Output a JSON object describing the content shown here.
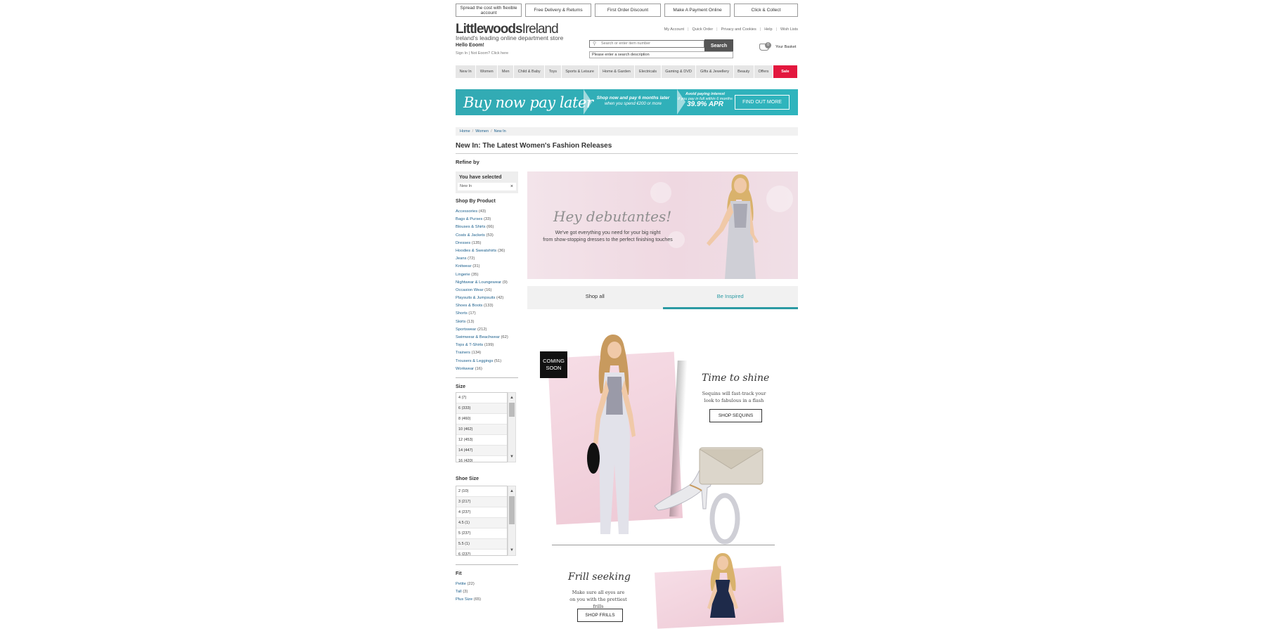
{
  "promos": [
    "Spread the cost with flexible account",
    "Free Delivery & Returns",
    "First Order Discount",
    "Make A Payment Online",
    "Click & Collect"
  ],
  "header": {
    "logo_bold": "Littlewoods",
    "logo_light": "Ireland",
    "tagline": "Ireland's leading online department store",
    "greeting": "Hello Eoom!",
    "signin": "Sign In | Not Eoom? Click here",
    "account_links": [
      "My Account",
      "Quick Order",
      "Privacy and Cookies",
      "Help",
      "Wish Lists"
    ],
    "search_placeholder": "Search or enter item number",
    "search_button": "Search",
    "search_error": "Please enter a search description",
    "basket_count": "0",
    "basket_label": "Your Basket"
  },
  "nav": [
    "New In",
    "Women",
    "Men",
    "Child & Baby",
    "Toys",
    "Sports & Leisure",
    "Home & Garden",
    "Electricals",
    "Gaming & DVD",
    "Gifts & Jewellery",
    "Beauty",
    "Offers",
    "Sale"
  ],
  "banner": {
    "headline": "Buy now pay later",
    "mid_line1": "Shop now and pay 6 months later",
    "mid_line2": "when you spend €200 or more",
    "right_line1": "Avoid paying interest",
    "right_line2": "if you pay in full within 6 months",
    "apr": "39.9% APR",
    "cta": "FIND OUT MORE"
  },
  "breadcrumb": [
    "Home",
    "Women",
    "New In"
  ],
  "page_title": "New In: The Latest Women's Fashion Releases",
  "refine": {
    "label": "Refine by",
    "selected_label": "You have selected",
    "selected_value": "New In",
    "remove": "×",
    "shop_by_product": "Shop By Product",
    "categories": [
      {
        "name": "Accessories",
        "count": "(43)"
      },
      {
        "name": "Bags & Purses",
        "count": "(33)"
      },
      {
        "name": "Blouses & Shirts",
        "count": "(66)"
      },
      {
        "name": "Coats & Jackets",
        "count": "(53)"
      },
      {
        "name": "Dresses",
        "count": "(135)"
      },
      {
        "name": "Hoodies & Sweatshirts",
        "count": "(36)"
      },
      {
        "name": "Jeans",
        "count": "(72)"
      },
      {
        "name": "Knitwear",
        "count": "(31)"
      },
      {
        "name": "Lingerie",
        "count": "(35)"
      },
      {
        "name": "Nightwear & Loungewear",
        "count": "(9)"
      },
      {
        "name": "Occasion Wear",
        "count": "(16)"
      },
      {
        "name": "Playsuits & Jumpsuits",
        "count": "(42)"
      },
      {
        "name": "Shoes & Boots",
        "count": "(133)"
      },
      {
        "name": "Shorts",
        "count": "(17)"
      },
      {
        "name": "Skirts",
        "count": "(13)"
      },
      {
        "name": "Sportswear",
        "count": "(212)"
      },
      {
        "name": "Swimwear & Beachwear",
        "count": "(62)"
      },
      {
        "name": "Tops & T-Shirts",
        "count": "(199)"
      },
      {
        "name": "Trainers",
        "count": "(134)"
      },
      {
        "name": "Trousers & Leggings",
        "count": "(51)"
      },
      {
        "name": "Workwear",
        "count": "(16)"
      }
    ],
    "size_label": "Size",
    "sizes": [
      "4  (7)",
      "6  (333)",
      "8  (460)",
      "10  (462)",
      "12  (453)",
      "14  (447)",
      "16  (420)"
    ],
    "shoe_size_label": "Shoe Size",
    "shoe_sizes": [
      "2  (10)",
      "3  (217)",
      "4  (237)",
      "4.5  (1)",
      "5  (237)",
      "5.5  (1)",
      "6  (237)"
    ],
    "fit_label": "Fit",
    "fits": [
      {
        "name": "Petite",
        "count": "(22)"
      },
      {
        "name": "Tall",
        "count": "(3)"
      },
      {
        "name": "Plus Size",
        "count": "(65)"
      }
    ]
  },
  "hero": {
    "title": "Hey debutantes!",
    "line1": "We've got everything you need for your big night",
    "line2": "from show-stopping dresses to the perfect finishing touches"
  },
  "tabs": [
    {
      "label": "Shop all",
      "active": false
    },
    {
      "label": "Be Inspired",
      "active": true
    }
  ],
  "editorial": {
    "badge": "COMING SOON",
    "shine_title": "Time to shine",
    "shine_sub": "Sequins will fast-track your look to fabulous in a flash",
    "shine_cta": "SHOP SEQUINS",
    "frill_title": "Frill seeking",
    "frill_sub": "Make sure all eyes are on you with the prettiest frills",
    "frill_cta": "SHOP FRILLS"
  },
  "colors": {
    "accent": "#2b9aa3",
    "sale": "#e3173e",
    "link": "#1b5f8c",
    "banner": "#32aab3"
  }
}
